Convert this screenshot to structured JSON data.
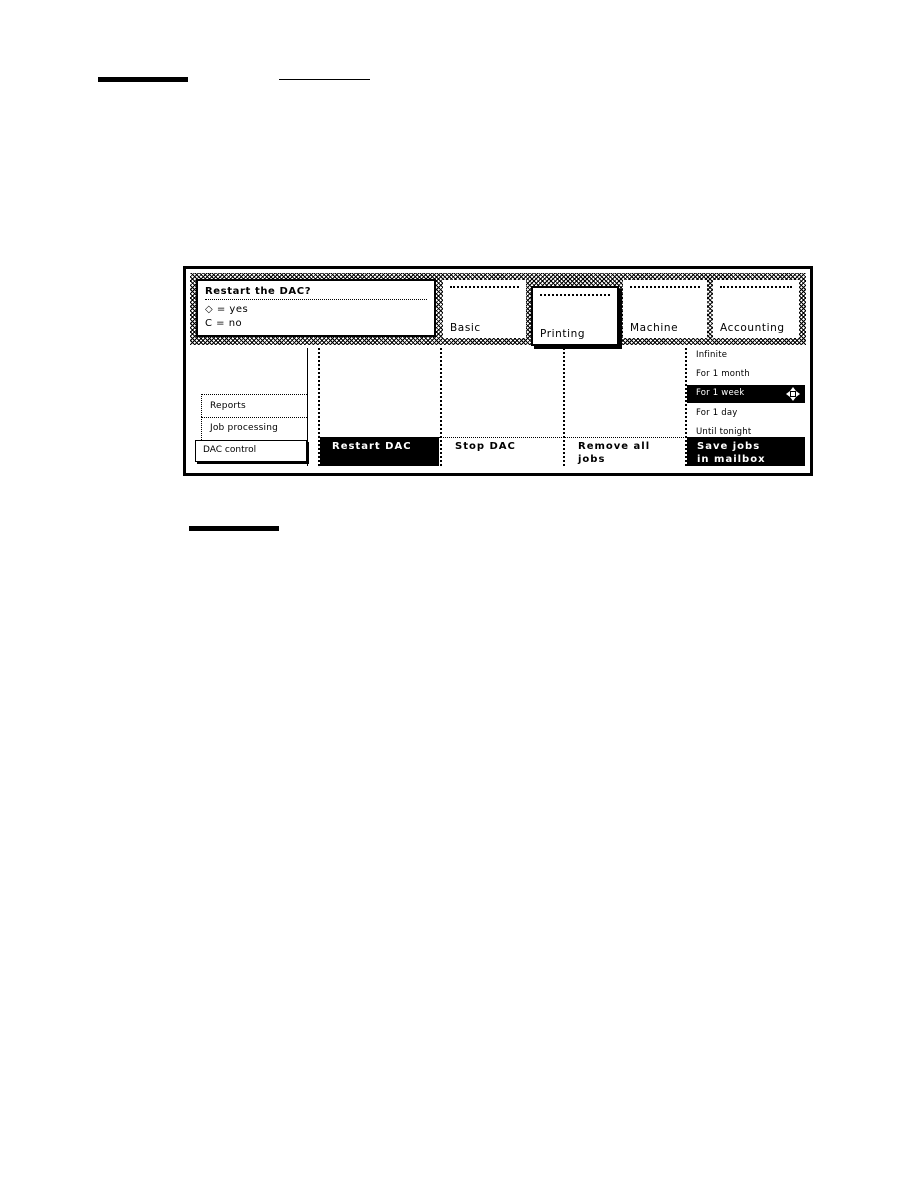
{
  "dialog": {
    "title": "Restart the DAC?",
    "yes_line": "◇ = yes",
    "no_line": "C = no"
  },
  "tabs": [
    {
      "label": "Basic",
      "active": false
    },
    {
      "label": "Printing",
      "active": true
    },
    {
      "label": "Machine",
      "active": false
    },
    {
      "label": "Accounting",
      "active": false
    }
  ],
  "side_menu": {
    "items": [
      "Reports",
      "Job processing"
    ],
    "selected": "DAC control"
  },
  "actions": {
    "restart": "Restart DAC",
    "stop": "Stop DAC",
    "remove_line1": "Remove all",
    "remove_line2": "jobs",
    "save_line1": "Save jobs",
    "save_line2": "in mailbox"
  },
  "retention": {
    "options": [
      "Infinite",
      "For 1 month",
      "For 1 week",
      "For 1 day",
      "Until tonight"
    ],
    "selected": "For 1 week"
  }
}
